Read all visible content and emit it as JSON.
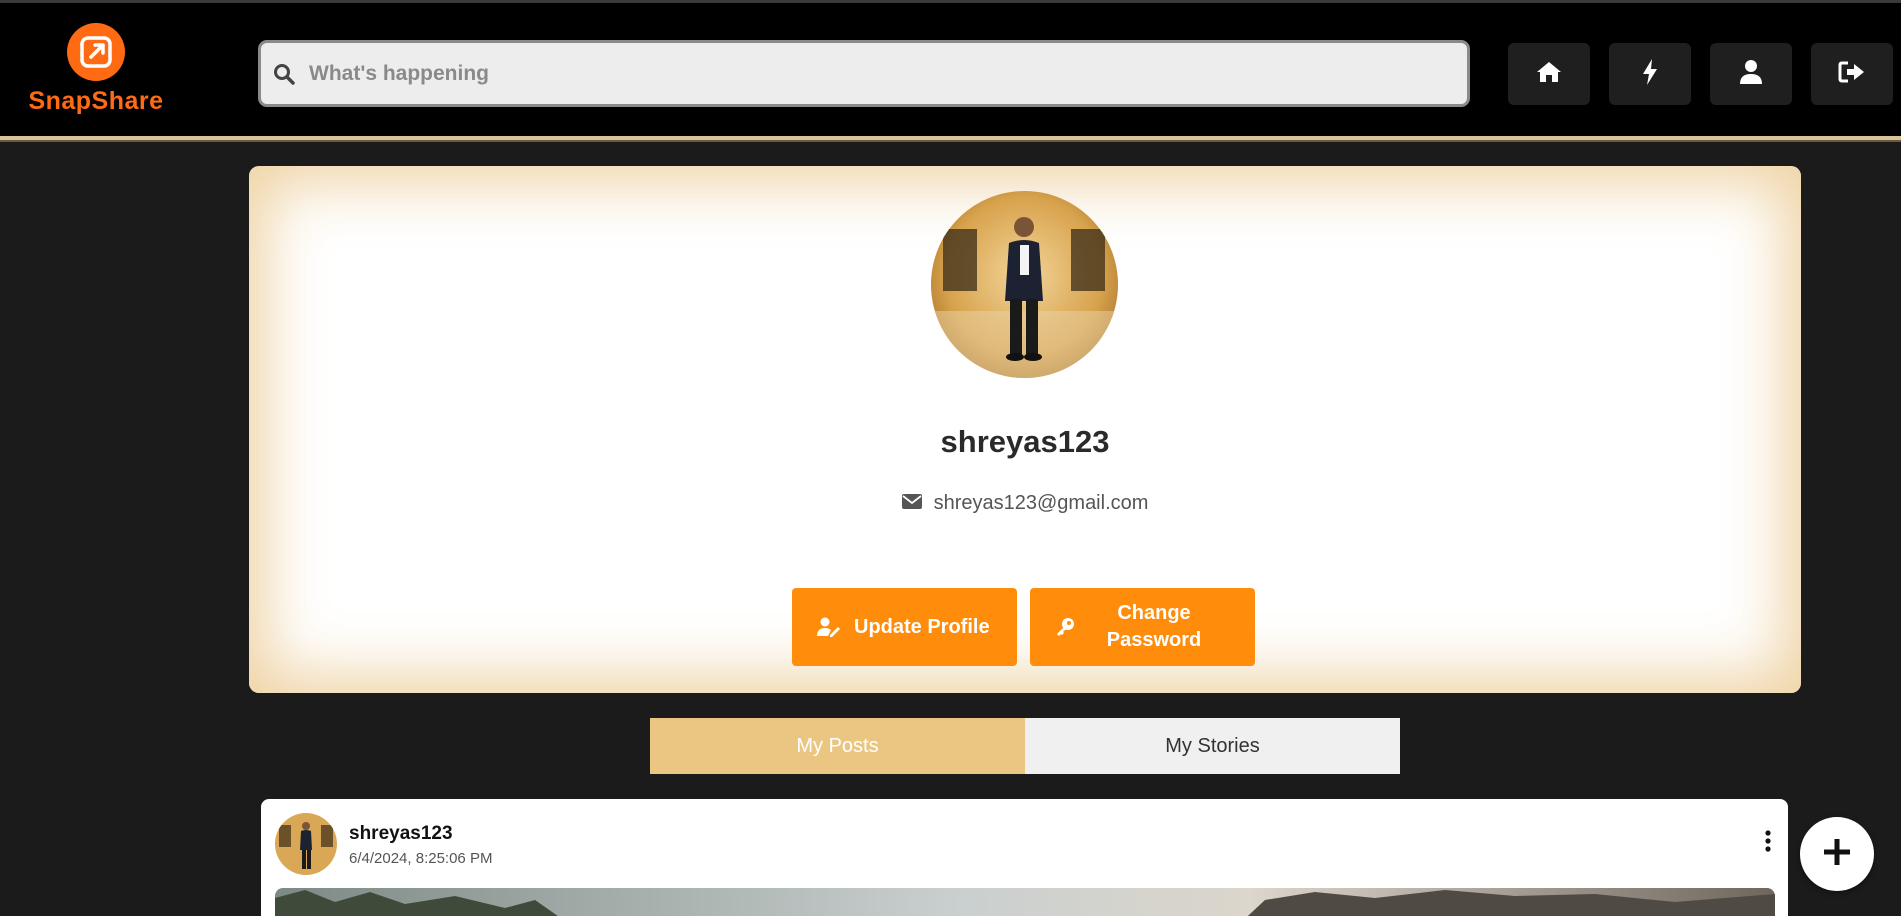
{
  "header": {
    "logo_text": "SnapShare",
    "search_placeholder": "What's happening",
    "nav": [
      {
        "icon": "home-icon"
      },
      {
        "icon": "bolt-icon"
      },
      {
        "icon": "user-icon"
      },
      {
        "icon": "logout-icon"
      }
    ]
  },
  "profile": {
    "username": "shreyas123",
    "email": "shreyas123@gmail.com",
    "update_label": "Update Profile",
    "change_password_label": "Change Password"
  },
  "tabs": {
    "posts": "My Posts",
    "stories": "My Stories",
    "active": "posts"
  },
  "post": {
    "username": "shreyas123",
    "timestamp": "6/4/2024, 8:25:06 PM"
  },
  "colors": {
    "accent": "#ff8c0a",
    "logo": "#ff6a13",
    "tab_active": "#eac682"
  }
}
